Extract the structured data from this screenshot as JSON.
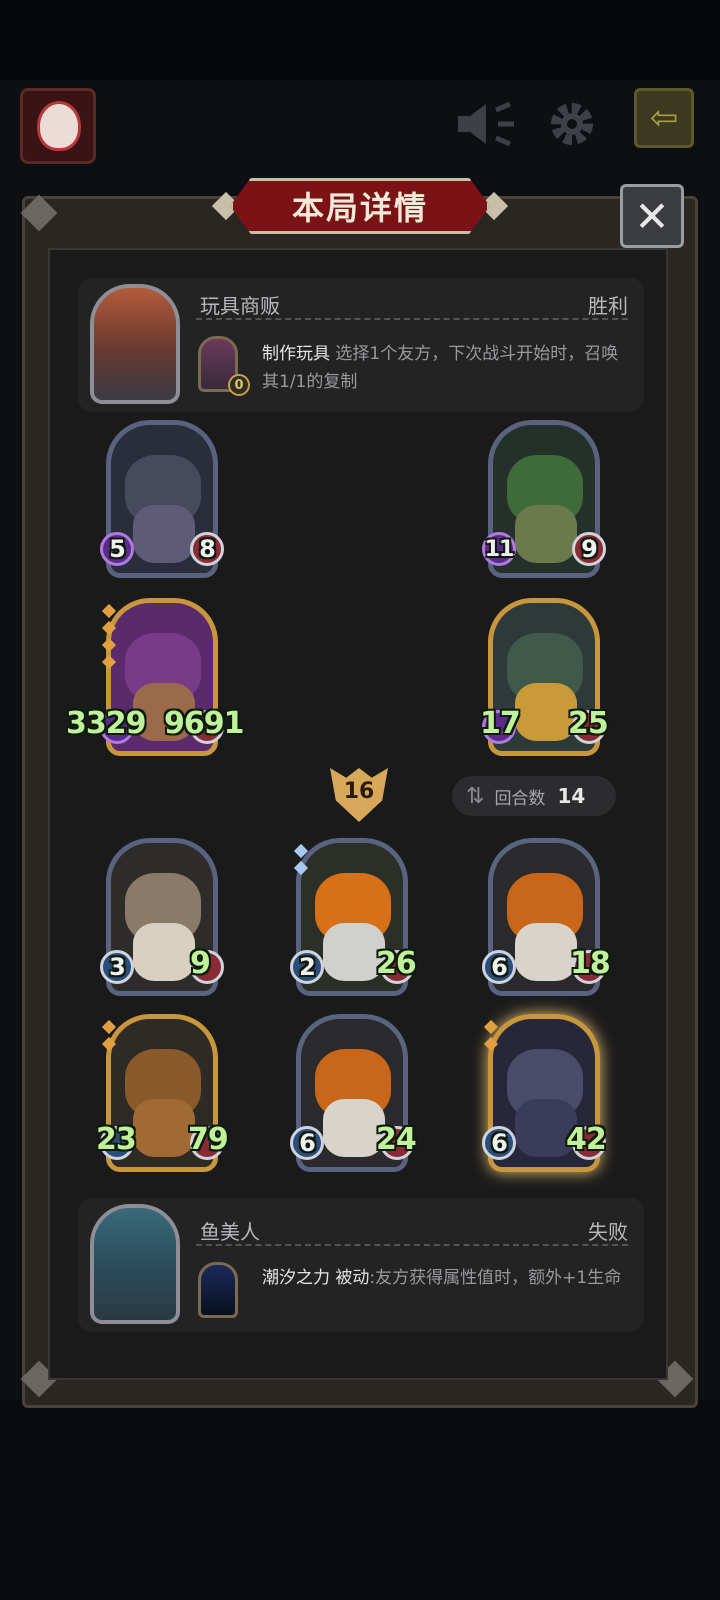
{
  "header": {
    "title": "本局详情",
    "close_icon": "close-icon",
    "avatar_icon": "player-avatar",
    "speaker_icon": "speaker-icon",
    "gear_icon": "gear-icon",
    "back_icon": "back-arrow-icon"
  },
  "opponent_top": {
    "name": "玩具商贩",
    "result": "胜利",
    "skill_name": "制作玩具",
    "skill_desc": "选择1个友方，下次战斗开始时，召唤其1/1的复制",
    "skill_counter": "0"
  },
  "top_board": [
    {
      "attack": "5",
      "health": "8",
      "art": "octopus-pirate"
    },
    {
      "attack": "11",
      "health": "9",
      "art": "cursed-sword"
    },
    {
      "attack": "3329",
      "health": "9691",
      "art": "spear-boy"
    },
    {
      "attack": "17",
      "health": "25",
      "art": "green-bird"
    }
  ],
  "center": {
    "level": "16",
    "turns_label": "回合数",
    "turns_value": "14",
    "turns_icon": "swap-icon"
  },
  "bottom_board": [
    {
      "attack": "3",
      "health": "9",
      "art": "old-scholar"
    },
    {
      "attack": "2",
      "health": "26",
      "art": "pumpkin-kid"
    },
    {
      "attack": "6",
      "health": "18",
      "art": "pumpkin-scarecrow"
    },
    {
      "attack": "23",
      "health": "79",
      "art": "mecha-bear"
    },
    {
      "attack": "6",
      "health": "24",
      "art": "pumpkin-scarecrow"
    },
    {
      "attack": "6",
      "health": "42",
      "art": "minotaur"
    }
  ],
  "player_bottom": {
    "name": "鱼美人",
    "result": "失败",
    "skill_name": "潮汐之力",
    "skill_tag": "被动",
    "skill_desc": ":友方获得属性值时，额外+1生命"
  }
}
